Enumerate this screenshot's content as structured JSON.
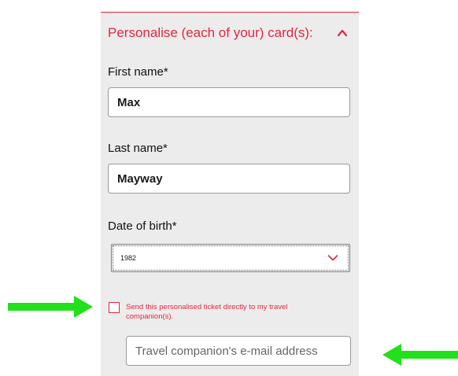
{
  "section": {
    "title": "Personalise (each of your) card(s):",
    "accent_color": "#e0283d"
  },
  "form": {
    "first_name": {
      "label": "First name*",
      "value": "Max"
    },
    "last_name": {
      "label": "Last name*",
      "value": "Mayway"
    },
    "date_of_birth": {
      "label": "Date of birth*",
      "selected": "1982"
    },
    "send_to_companion": {
      "label": "Send this personalised ticket directly to my travel companion(s).",
      "checked": false
    },
    "companion_email": {
      "value": "",
      "placeholder": "Travel companion's e-mail address"
    }
  },
  "annotations": {
    "arrow_color": "#22e01a",
    "left_arrow_icon": "arrow-right-icon",
    "right_arrow_icon": "arrow-left-icon"
  }
}
